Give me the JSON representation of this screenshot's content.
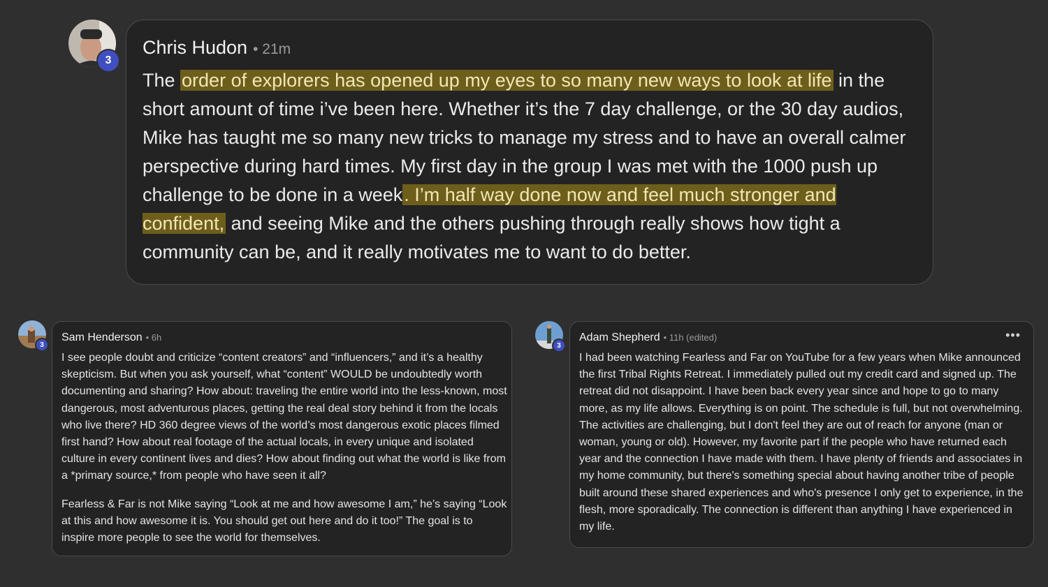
{
  "main_post": {
    "author": "Chris Hudon",
    "time": "• 21m",
    "badge": "3",
    "segments": [
      {
        "text": "The ",
        "hl": false
      },
      {
        "text": "order of explorers has opened up my eyes to so many new ways to look at life",
        "hl": true
      },
      {
        "text": " in the short amount of time i’ve been here. Whether it’s the 7 day challenge, or the 30 day audios, Mike has taught me so many new tricks to manage my stress and to have an overall calmer perspective during hard times. My first day in the group I was met with the 1000 push up challenge to be done in a week",
        "hl": false
      },
      {
        "text": ". I’m half way done now and feel much stronger and confident,",
        "hl": true
      },
      {
        "text": " and seeing Mike and the others pushing through really shows how tight a community can be, and it really motivates me to want to do better.",
        "hl": false
      }
    ]
  },
  "comment_left": {
    "author": "Sam Henderson",
    "time": "• 6h",
    "badge": "3",
    "paragraphs": [
      "I see people doubt and criticize “content creators” and “influencers,” and it’s a healthy skepticism. But when you ask yourself, what “content” WOULD be undoubtedly worth documenting and sharing? How about: traveling the entire world into the less-known, most dangerous, most adventurous places, getting the real deal story behind it from the locals who live there? HD 360 degree views of the world’s most dangerous exotic places filmed first hand? How about real footage of the actual locals, in every unique and isolated culture in every continent lives and dies? How about finding out what the world is like from a *primary source,* from people who have seen it all?",
      "Fearless & Far is not Mike saying “Look at me and how awesome I am,” he’s saying “Look at this and how awesome it is. You should get out here and do it too!” The goal is to inspire more people to see the world for themselves."
    ]
  },
  "comment_right": {
    "author": "Adam Shepherd",
    "time": "• 11h (edited)",
    "badge": "3",
    "more_label": "•••",
    "paragraphs": [
      "I had been watching Fearless and Far on YouTube for a few years when Mike announced the first Tribal Rights Retreat. I immediately pulled out my credit card and signed up. The retreat did not disappoint. I have been back every year since and hope to go to many more, as my life allows. Everything is on point. The schedule is full, but not overwhelming. The activities are challenging, but I don't feel they are out of reach for anyone (man or woman, young or old). However, my favorite part if the people who have returned each year and the connection I have made with them. I have plenty of friends and associates in my home community, but there's something special about having another tribe of people built around these shared experiences and who's presence I only get to experience, in the flesh, more sporadically. The connection is different than anything I have experienced in my life."
    ]
  },
  "colors": {
    "background": "#2f2f30",
    "card": "#232324",
    "highlight": "#6d5e1c",
    "badge": "#3f4fbf"
  }
}
